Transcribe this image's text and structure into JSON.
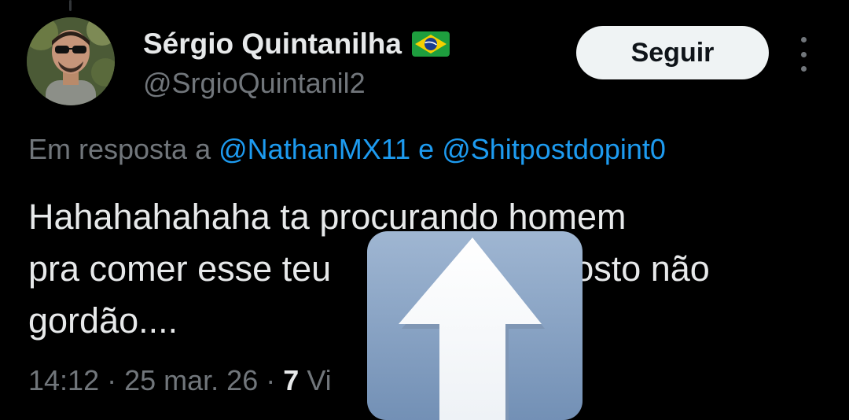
{
  "tweet": {
    "author": {
      "display_name": "Sérgio Quintanilha",
      "flag_icon": "brazil-flag-icon",
      "handle": "@SrgioQuintanil2"
    },
    "follow_label": "Seguir",
    "more_icon": "more-vertical-icon",
    "reply_to": {
      "prefix": "Em resposta a",
      "mention_1": "@NathanMX11",
      "joiner": "e",
      "mention_2": "@Shitpostdopint0"
    },
    "text": {
      "line_1": "Hahahahahaha ta procurando homem",
      "line_2_start": "pra comer esse teu",
      "line_2_end": "Gosto não",
      "line_3": "gordão...."
    },
    "meta": {
      "time": "14:12",
      "separator": "·",
      "date": "25 mar. 26",
      "views_count": "7",
      "views_label": "Vi"
    },
    "overlay": {
      "icon": "up-arrow-emoji-icon"
    }
  },
  "colors": {
    "background": "#000000",
    "text_primary": "#e7e9ea",
    "text_secondary": "#71767b",
    "link": "#1d9bf0",
    "follow_button_bg": "#eff3f4",
    "emoji_bg": "#8aa3c2"
  }
}
